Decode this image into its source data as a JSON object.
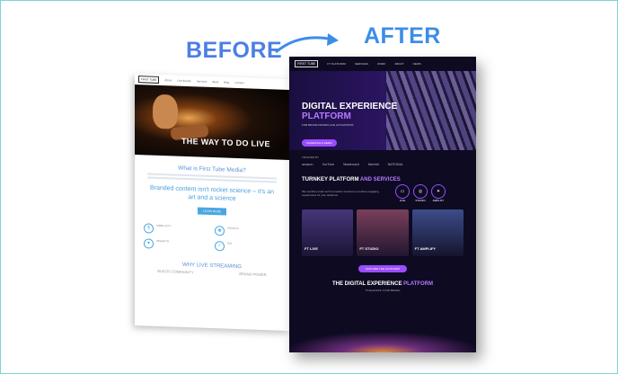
{
  "header": {
    "before_title": "BEFORE",
    "after_title": "AFTER"
  },
  "before_site": {
    "logo": "FIRST TUBE",
    "nav": [
      "About",
      "Live Events",
      "Services",
      "Work",
      "Blog",
      "Contact"
    ],
    "hero_text": "THE WAY TO DO LIVE",
    "what_heading": "What is First Tube Media?",
    "big_text": "Branded content isn't rocket science – it's an art and a science",
    "button_label": "LEARN MORE",
    "features": [
      {
        "icon": "dollar-icon",
        "label": "SIMPLICITY"
      },
      {
        "icon": "eye-icon",
        "label": "VISUALS"
      },
      {
        "icon": "heart-icon",
        "label": "INSIGHTS"
      },
      {
        "icon": "check-icon",
        "label": "ROI"
      }
    ],
    "why_heading": "WHY LIVE STREAMING",
    "cols": [
      "BUILDS COMMUNITY",
      "BRAND POWER"
    ]
  },
  "after_site": {
    "logo": "FIRST TUBE",
    "nav": [
      "FT PLATFORM",
      "SERVICES",
      "WORK",
      "ABOUT",
      "NEWS"
    ],
    "hero_line1": "DIGITAL EXPERIENCE",
    "hero_line2": "PLATFORM",
    "hero_sub": "FOR BRAND DRIVEN LIVE ACTIVATIONS",
    "hero_button": "SCHEDULE A DEMO",
    "trusted": "TRUSTED BY",
    "trusted_logos": [
      "amazon",
      "YouTube",
      "Mastercard",
      "Marriott",
      "NATIONAL"
    ],
    "platform_heading_a": "TURNKEY PLATFORM",
    "platform_heading_b": "AND SERVICES",
    "platform_desc": "We combine smart tech & creative services to produce engaging experiences for your audience.",
    "circles": [
      "LIVE",
      "STUDIO",
      "AMPLIFY"
    ],
    "cards": [
      "FT LIVE",
      "FT STUDIO",
      "FT AMPLIFY"
    ],
    "cards_button": "EXPLORE THE PLATFORM",
    "bottom_heading_a": "THE DIGITAL EXPERIENCE",
    "bottom_heading_b": "PLATFORM",
    "bottom_sub": "TO ELEVATE YOUR BRAND"
  },
  "colors": {
    "before_accent": "#4aa7e0",
    "after_accent": "#9c4dff",
    "after_bg": "#0d0a22"
  }
}
